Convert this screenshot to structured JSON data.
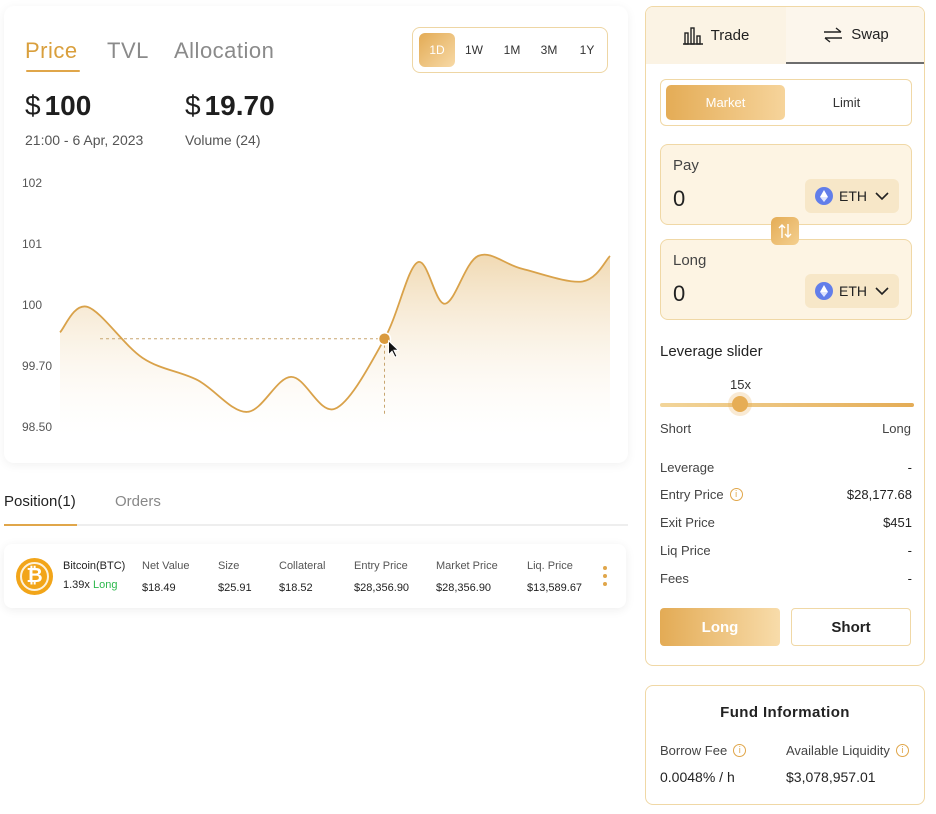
{
  "chart_tabs": [
    "Price",
    "TVL",
    "Allocation"
  ],
  "ranges": [
    "1D",
    "1W",
    "1M",
    "3M",
    "1Y"
  ],
  "price": {
    "currency": "$",
    "value": "100",
    "time": "21:00 - 6 Apr, 2023"
  },
  "volume": {
    "currency": "$",
    "value": "19.70",
    "label": "Volume (24)"
  },
  "chart_data": {
    "type": "area",
    "y_ticks": [
      "102",
      "101",
      "100",
      "99.70",
      "98.50"
    ],
    "series": [
      {
        "x": [
          0,
          0.05,
          0.15,
          0.25,
          0.34,
          0.42,
          0.5,
          0.59,
          0.65,
          0.7,
          0.76,
          0.84,
          0.95,
          1
        ],
        "values": [
          99.7,
          100.1,
          99.3,
          98.95,
          98.45,
          99.0,
          98.5,
          99.6,
          100.8,
          100.15,
          100.9,
          100.7,
          100.5,
          100.9
        ]
      }
    ],
    "highlight_x": 0.59,
    "highlight_y": 99.6
  },
  "position_tabs": [
    "Position(1)",
    "Orders"
  ],
  "position": {
    "asset": "Bitcoin(BTC)",
    "leverage": "1.39x",
    "side": "Long",
    "columns": [
      "Net Value",
      "Size",
      "Collateral",
      "Entry Price",
      "Market Price",
      "Liq. Price"
    ],
    "values": [
      "$18.49",
      "$25.91",
      "$18.52",
      "$28,356.90",
      "$28,356.90",
      "$13,589.67"
    ]
  },
  "trade": {
    "tabs": [
      "Trade",
      "Swap"
    ],
    "order_types": [
      "Market",
      "Limit"
    ],
    "pay": {
      "label": "Pay",
      "value": "0",
      "token": "ETH"
    },
    "long": {
      "label": "Long",
      "value": "0",
      "token": "ETH"
    },
    "leverage_title": "Leverage slider",
    "leverage_value": "15x",
    "slider_left": "Short",
    "slider_right": "Long",
    "info": [
      {
        "label": "Leverage",
        "value": "-",
        "info_icon": false
      },
      {
        "label": "Entry Price",
        "value": "$28,177.68",
        "info_icon": true
      },
      {
        "label": "Exit Price",
        "value": "$451",
        "info_icon": false
      },
      {
        "label": "Liq Price",
        "value": "-",
        "info_icon": false
      },
      {
        "label": "Fees",
        "value": "-",
        "info_icon": false
      }
    ],
    "long_button": "Long",
    "short_button": "Short"
  },
  "fund": {
    "title": "Fund Information",
    "borrow_fee_label": "Borrow Fee",
    "borrow_fee_value": "0.0048% / h",
    "liquidity_label": "Available Liquidity",
    "liquidity_value": "$3,078,957.01"
  },
  "colors": {
    "accent": "#e0a64a",
    "accent_light": "#f6d49b",
    "line": "#d9a24a",
    "long_green": "#2db84d",
    "eth_blue": "#627eea"
  }
}
